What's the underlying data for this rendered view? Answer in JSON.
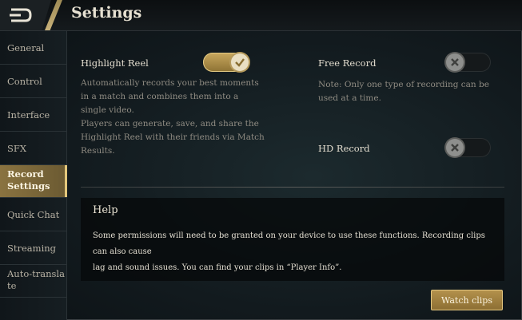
{
  "header": {
    "title": "Settings"
  },
  "sidebar": {
    "items": [
      {
        "label": "General"
      },
      {
        "label": "Control"
      },
      {
        "label": "Interface"
      },
      {
        "label": "SFX"
      },
      {
        "label_line1": "Record",
        "label_line2": "Settings",
        "active": true
      },
      {
        "label": "Quick Chat"
      },
      {
        "label": "Streaming"
      },
      {
        "label_line1": "Auto-transla",
        "label_line2": "te"
      }
    ]
  },
  "highlight_reel": {
    "label": "Highlight Reel",
    "enabled": true,
    "desc_line1": "Automatically records your best moments",
    "desc_line2": "in a match and combines them into a",
    "desc_line3": "single video.",
    "desc_line4": "Players can generate, save, and share the",
    "desc_line5": "Highlight Reel with their friends via Match",
    "desc_line6": "Results."
  },
  "free_record": {
    "label": "Free Record",
    "enabled": false,
    "note_line1": "Note: Only one type of recording can be",
    "note_line2": "used at a time."
  },
  "hd_record": {
    "label": "HD Record",
    "enabled": false
  },
  "help": {
    "title": "Help",
    "line1": "Some permissions will need to be granted on your device to use these functions. Recording clips can also cause",
    "line2": "lag and sound issues. You can find your clips in “Player Info”."
  },
  "watch_button": {
    "label": "Watch clips"
  },
  "colors": {
    "accent_gold": "#c9a85e",
    "active_tab": "#8a7340"
  }
}
